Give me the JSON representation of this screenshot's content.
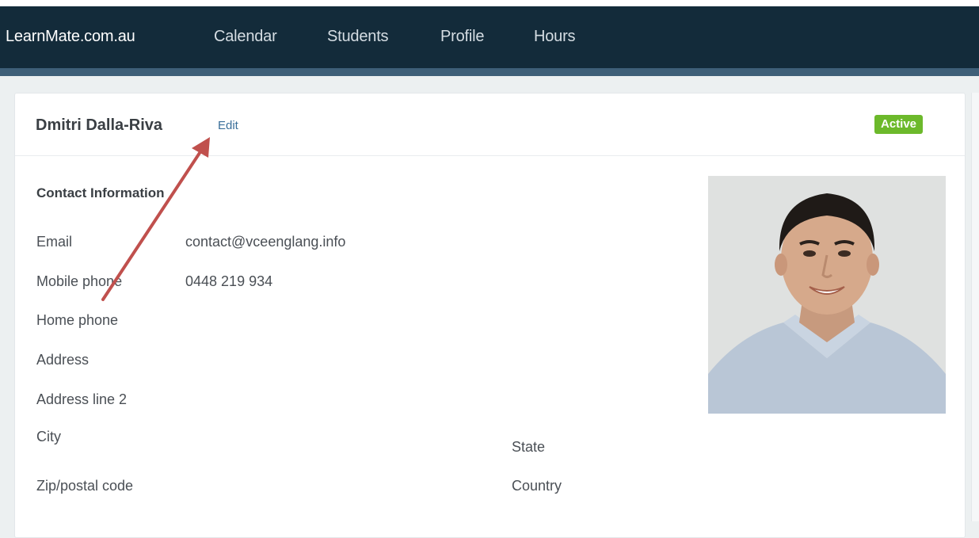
{
  "nav": {
    "brand": "LearnMate.com.au",
    "links": [
      "Calendar",
      "Students",
      "Profile",
      "Hours"
    ]
  },
  "profile": {
    "name": "Dmitri Dalla-Riva",
    "edit_label": "Edit",
    "status": "Active",
    "status_color": "#6cb92b"
  },
  "contact": {
    "section_title": "Contact Information",
    "email_label": "Email",
    "email_value": "contact@vceenglang.info",
    "mobile_label": "Mobile phone",
    "mobile_value": "0448 219 934",
    "home_phone_label": "Home phone",
    "address_label": "Address",
    "address2_label": "Address line 2",
    "city_label": "City",
    "state_label": "State",
    "zip_label": "Zip/postal code",
    "country_label": "Country"
  },
  "colors": {
    "nav_bg": "#132b3a",
    "nav_border": "#3e5f78",
    "annotation_arrow": "#c0504d"
  },
  "icons": {
    "avatar": "user-photo",
    "annotation": "arrow-annotation"
  }
}
